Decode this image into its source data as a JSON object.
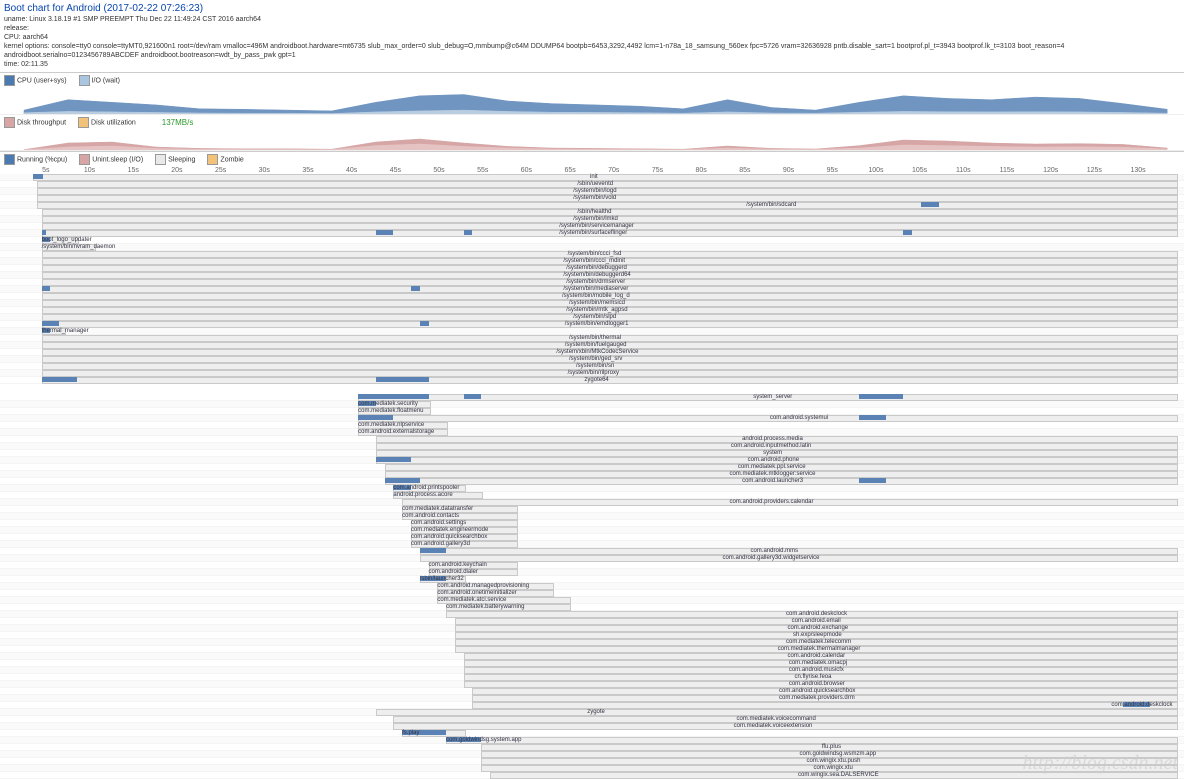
{
  "header": {
    "title": "Boot chart for Android (2017-02-22 07:26:23)",
    "uname": "uname: Linux 3.18.19 #1 SMP PREEMPT Thu Dec 22 11:49:24 CST 2016 aarch64",
    "release": "release:",
    "cpu": "CPU: aarch64",
    "cmdline": "kernel options: console=tty0 console=ttyMT0,921600n1 root=/dev/ram vmalloc=496M androidboot.hardware=mt6735 slub_max_order=0 slub_debug=O,mmbump@c64M DDUMP64 bootpb=6453,3292,4492 lcm=1-n78a_18_samsung_560ex fpc=5726 vram=32636928 pntb.disable_sart=1 bootprof.pl_t=3943 bootprof.lk_t=3103 boot_reason=4 androidboot.serialno=0123456789ABCDEF androidboot.bootreason=wdt_by_pass_pwk gpt=1",
    "time": "time: 02:11.35"
  },
  "legend_cpu": {
    "title": "CPU (user+sys)",
    "io": "I/O (wait)"
  },
  "legend_disk": {
    "title": "Disk throughput",
    "value": "137MB/s",
    "disk_util": "Disk utilization"
  },
  "legend_proc": {
    "running": "Running (%cpu)",
    "unint": "Unint.sleep (I/O)",
    "sleeping": "Sleeping",
    "zombie": "Zombie"
  },
  "ticks": [
    "5s",
    "10s",
    "15s",
    "20s",
    "25s",
    "30s",
    "35s",
    "40s",
    "45s",
    "50s",
    "55s",
    "60s",
    "65s",
    "70s",
    "75s",
    "80s",
    "85s",
    "90s",
    "95s",
    "100s",
    "105s",
    "110s",
    "115s",
    "120s",
    "125s",
    "130s"
  ],
  "watermark": "http://blog.csdn.net",
  "chart_data": {
    "type": "gantt",
    "title": "Boot chart for Android (2017-02-22 07:26:23)",
    "x_unit": "seconds",
    "x_range": [
      0,
      131
    ],
    "cpu_wave": {
      "description": "CPU (user+sys) and I/O(wait) stacked area",
      "samples_s": [
        0,
        5,
        10,
        15,
        20,
        25,
        30,
        35,
        40,
        45,
        50,
        55,
        60,
        65,
        70,
        75,
        80,
        85,
        90,
        95,
        100,
        105,
        110,
        115,
        120,
        125,
        130
      ],
      "cpu_pct": [
        15,
        55,
        45,
        35,
        20,
        18,
        15,
        12,
        45,
        70,
        75,
        50,
        40,
        35,
        30,
        20,
        55,
        25,
        15,
        45,
        70,
        60,
        55,
        65,
        60,
        40,
        18
      ],
      "io_pct": [
        5,
        10,
        8,
        6,
        4,
        3,
        3,
        2,
        8,
        12,
        15,
        10,
        7,
        6,
        5,
        3,
        8,
        4,
        3,
        7,
        10,
        9,
        8,
        9,
        8,
        6,
        3
      ]
    },
    "disk_wave": {
      "description": "Disk throughput (pink) and utilization stacked",
      "samples_s": [
        0,
        5,
        10,
        15,
        20,
        25,
        30,
        35,
        40,
        45,
        50,
        55,
        60,
        65,
        70,
        75,
        80,
        85,
        90,
        95,
        100,
        105,
        110,
        115,
        120,
        125,
        130
      ],
      "thr_pct": [
        2,
        35,
        40,
        15,
        8,
        6,
        6,
        4,
        40,
        55,
        35,
        18,
        10,
        8,
        6,
        4,
        20,
        8,
        5,
        22,
        50,
        45,
        35,
        30,
        32,
        28,
        10
      ],
      "util_pct": [
        1,
        15,
        20,
        8,
        4,
        3,
        3,
        2,
        22,
        30,
        18,
        10,
        5,
        4,
        3,
        2,
        10,
        4,
        3,
        10,
        25,
        22,
        18,
        15,
        16,
        14,
        5
      ]
    },
    "processes": [
      {
        "name": "init",
        "start": 1,
        "end": 131,
        "label_x": 65,
        "activity": [
          [
            1,
            2
          ],
          [
            1.5,
            2.2
          ]
        ]
      },
      {
        "name": "/sbin/ueventd",
        "start": 1.5,
        "end": 131,
        "label_x": 65
      },
      {
        "name": "/system/bin/logd",
        "start": 1.5,
        "end": 131,
        "label_x": 65
      },
      {
        "name": "/system/bin/vold",
        "start": 1.5,
        "end": 131,
        "label_x": 65
      },
      {
        "name": "/system/bin/sdcard",
        "start": 1.5,
        "end": 131,
        "label_x": 85,
        "activity": [
          [
            102,
            104
          ]
        ]
      },
      {
        "name": "/sbin/healthd",
        "start": 2,
        "end": 131,
        "label_x": 65
      },
      {
        "name": "/system/bin/lmkd",
        "start": 2,
        "end": 131,
        "label_x": 65
      },
      {
        "name": "/system/bin/servicemanager",
        "start": 2,
        "end": 131,
        "label_x": 65
      },
      {
        "name": "/system/bin/surfaceflinger",
        "start": 2,
        "end": 131,
        "label_x": 65,
        "activity": [
          [
            2,
            2.5
          ],
          [
            40,
            42
          ],
          [
            50,
            51
          ],
          [
            100,
            101
          ]
        ]
      },
      {
        "name": "boot_logo_updater",
        "start": 2,
        "end": 6,
        "label_x": 6,
        "label_side": "left",
        "activity": [
          [
            2,
            3
          ]
        ]
      },
      {
        "name": "/system/bin/nvram_daemon",
        "start": 2,
        "end": 8,
        "label_x": 8,
        "label_side": "left"
      },
      {
        "name": "/system/bin/ccci_fsd",
        "start": 2,
        "end": 131,
        "label_x": 65
      },
      {
        "name": "/system/bin/ccci_mdinit",
        "start": 2,
        "end": 131,
        "label_x": 65
      },
      {
        "name": "/system/bin/debuggerd",
        "start": 2,
        "end": 131,
        "label_x": 65
      },
      {
        "name": "/system/bin/debuggerd64",
        "start": 2,
        "end": 131,
        "label_x": 65
      },
      {
        "name": "/system/bin/drmserver",
        "start": 2,
        "end": 131,
        "label_x": 65
      },
      {
        "name": "/system/bin/mediaserver",
        "start": 2,
        "end": 131,
        "label_x": 65,
        "activity": [
          [
            2,
            3
          ],
          [
            44,
            45
          ]
        ]
      },
      {
        "name": "/system/bin/mobile_log_d",
        "start": 2,
        "end": 131,
        "label_x": 65
      },
      {
        "name": "/system/bin/memsicd",
        "start": 2,
        "end": 131,
        "label_x": 65
      },
      {
        "name": "/system/bin/mtk_agpsd",
        "start": 2,
        "end": 131,
        "label_x": 65
      },
      {
        "name": "/system/bin/slpd",
        "start": 2,
        "end": 131,
        "label_x": 65
      },
      {
        "name": "/system/bin/emdlogger1",
        "start": 2,
        "end": 131,
        "label_x": 65,
        "activity": [
          [
            2,
            4
          ],
          [
            45,
            46
          ]
        ]
      },
      {
        "name": "thermal_manager",
        "start": 2,
        "end": 4.5,
        "label_x": 4.5,
        "label_side": "left",
        "activity": [
          [
            2,
            3
          ]
        ]
      },
      {
        "name": "/system/bin/thermal",
        "start": 2,
        "end": 131,
        "label_x": 65
      },
      {
        "name": "/system/bin/fuelgauged",
        "start": 2,
        "end": 131,
        "label_x": 65
      },
      {
        "name": "/system/xbin/MtkCodecService",
        "start": 2,
        "end": 131,
        "label_x": 65
      },
      {
        "name": "/system/bin/ged_srv",
        "start": 2,
        "end": 131,
        "label_x": 65
      },
      {
        "name": "/system/bin/sn",
        "start": 2,
        "end": 131,
        "label_x": 65
      },
      {
        "name": "/system/bin/rilproxy",
        "start": 2,
        "end": 131,
        "label_x": 65
      },
      {
        "name": "zygote64",
        "start": 2,
        "end": 131,
        "label_x": 65,
        "activity": [
          [
            2,
            6
          ],
          [
            40,
            46
          ]
        ]
      },
      {
        "name": "system_server",
        "start": 38,
        "end": 131,
        "label_x": 85,
        "activity": [
          [
            38,
            46
          ],
          [
            50,
            52
          ],
          [
            95,
            100
          ]
        ]
      },
      {
        "name": "com.mediatek.security",
        "start": 38,
        "end": 46,
        "label_x": 46,
        "label_side": "left",
        "activity": [
          [
            38,
            40
          ]
        ]
      },
      {
        "name": "com.mediatek.floatmenu",
        "start": 38,
        "end": 46,
        "label_x": 46,
        "label_side": "left"
      },
      {
        "name": "com.android.systemui",
        "start": 38,
        "end": 131,
        "label_x": 88,
        "activity": [
          [
            38,
            42
          ],
          [
            95,
            98
          ]
        ]
      },
      {
        "name": "com.mediatek.nlpservice",
        "start": 38,
        "end": 48,
        "label_x": 48,
        "label_side": "left"
      },
      {
        "name": "com.android.externalstorage",
        "start": 38,
        "end": 48,
        "label_x": 48,
        "label_side": "left"
      },
      {
        "name": "android.process.media",
        "start": 40,
        "end": 131,
        "label_x": 85
      },
      {
        "name": "com.android.inputmethod.latin",
        "start": 40,
        "end": 131,
        "label_x": 85
      },
      {
        "name": "system",
        "start": 40,
        "end": 131,
        "label_x": 85
      },
      {
        "name": "com.android.phone",
        "start": 40,
        "end": 131,
        "label_x": 85,
        "activity": [
          [
            40,
            44
          ]
        ]
      },
      {
        "name": "com.mediatek.ppl.service",
        "start": 41,
        "end": 131,
        "label_x": 85
      },
      {
        "name": "com.mediatek.mtklogger:service",
        "start": 41,
        "end": 131,
        "label_x": 85
      },
      {
        "name": "com.android.launcher3",
        "start": 41,
        "end": 131,
        "label_x": 85,
        "activity": [
          [
            41,
            45
          ],
          [
            95,
            98
          ]
        ]
      },
      {
        "name": "com.android.printspooler",
        "start": 42,
        "end": 50,
        "label_x": 50,
        "label_side": "left",
        "activity": [
          [
            42,
            44
          ]
        ]
      },
      {
        "name": "android.process.acore",
        "start": 42,
        "end": 52,
        "label_x": 52,
        "label_side": "left"
      },
      {
        "name": "com.android.providers.calendar",
        "start": 43,
        "end": 131,
        "label_x": 85
      },
      {
        "name": "com.mediatek.datatransfer",
        "start": 43,
        "end": 56,
        "label_x": 56,
        "label_side": "left"
      },
      {
        "name": "com.android.contacts",
        "start": 43,
        "end": 56,
        "label_x": 56,
        "label_side": "left"
      },
      {
        "name": "com.android.settings",
        "start": 44,
        "end": 56,
        "label_x": 56,
        "label_side": "left"
      },
      {
        "name": "com.mediatek.engineermode",
        "start": 44,
        "end": 56,
        "label_x": 56,
        "label_side": "left"
      },
      {
        "name": "com.android.quicksearchbox",
        "start": 44,
        "end": 56,
        "label_x": 56,
        "label_side": "left"
      },
      {
        "name": "com.android.gallery3d",
        "start": 44,
        "end": 56,
        "label_x": 56,
        "label_side": "left"
      },
      {
        "name": "com.android.mms",
        "start": 45,
        "end": 131,
        "label_x": 85,
        "activity": [
          [
            45,
            48
          ]
        ]
      },
      {
        "name": "com.android.gallery3d.widgetservice",
        "start": 45,
        "end": 131,
        "label_x": 85
      },
      {
        "name": "com.android.keychain",
        "start": 46,
        "end": 56,
        "label_x": 56,
        "label_side": "left"
      },
      {
        "name": "com.android.dialer",
        "start": 46,
        "end": 56,
        "label_x": 56,
        "label_side": "left"
      },
      {
        "name": "/sbin/launcher32",
        "start": 45,
        "end": 50,
        "label_x": 50,
        "label_side": "left",
        "activity": [
          [
            45,
            48
          ]
        ]
      },
      {
        "name": "com.android.managedprovisioning",
        "start": 47,
        "end": 60,
        "label_x": 60,
        "label_side": "left"
      },
      {
        "name": "com.android.onetimeinitializer",
        "start": 47,
        "end": 60,
        "label_x": 60,
        "label_side": "left"
      },
      {
        "name": "com.mediatek.atci.service",
        "start": 47,
        "end": 62,
        "label_x": 62,
        "label_side": "left"
      },
      {
        "name": "com.mediatek.batterywarning",
        "start": 48,
        "end": 62,
        "label_x": 62,
        "label_side": "left"
      },
      {
        "name": "com.android.deskclock",
        "start": 48,
        "end": 131,
        "label_x": 90
      },
      {
        "name": "com.android.email",
        "start": 49,
        "end": 131,
        "label_x": 90
      },
      {
        "name": "com.android.exchange",
        "start": 49,
        "end": 131,
        "label_x": 90
      },
      {
        "name": "sh.exp/sleepmode",
        "start": 49,
        "end": 131,
        "label_x": 90
      },
      {
        "name": "com.mediatek.telecomm",
        "start": 49,
        "end": 131,
        "label_x": 90
      },
      {
        "name": "com.mediatek.thermalmanager",
        "start": 49,
        "end": 131,
        "label_x": 90
      },
      {
        "name": "com.android.calendar",
        "start": 50,
        "end": 131,
        "label_x": 90
      },
      {
        "name": "com.mediatek.omacpj",
        "start": 50,
        "end": 131,
        "label_x": 90
      },
      {
        "name": "com.android.musicfx",
        "start": 50,
        "end": 131,
        "label_x": 90
      },
      {
        "name": "cn.flyrise.feoa",
        "start": 50,
        "end": 131,
        "label_x": 90
      },
      {
        "name": "com.android.browser",
        "start": 50,
        "end": 131,
        "label_x": 90
      },
      {
        "name": "com.android.quicksearchbox",
        "start": 51,
        "end": 131,
        "label_x": 90
      },
      {
        "name": "com.mediatek.providers.drm",
        "start": 51,
        "end": 131,
        "label_x": 90
      },
      {
        "name": "com.android.deskclock",
        "start": 51,
        "end": 131,
        "label_x": 127,
        "activity": [
          [
            125,
            128
          ]
        ]
      },
      {
        "name": "zygote",
        "start": 40,
        "end": 131,
        "label_x": 65
      },
      {
        "name": "com.mediatek.voicecommand",
        "start": 42,
        "end": 131,
        "label_x": 85
      },
      {
        "name": "com.mediatek.voiceextension",
        "start": 42,
        "end": 131,
        "label_x": 85
      },
      {
        "name": "fs.play",
        "start": 43,
        "end": 50,
        "label_x": 50,
        "label_side": "left",
        "activity": [
          [
            43,
            48
          ]
        ]
      },
      {
        "name": "com.goldwindsg.system.app",
        "start": 48,
        "end": 131,
        "label_x": 62,
        "label_side": "left",
        "activity": [
          [
            48,
            52
          ]
        ]
      },
      {
        "name": "ffu.plus",
        "start": 52,
        "end": 131,
        "label_x": 92
      },
      {
        "name": "com.goldwindsg.wsmzm.app",
        "start": 52,
        "end": 131,
        "label_x": 92
      },
      {
        "name": "com.wingix.xtu.push",
        "start": 52,
        "end": 131,
        "label_x": 92
      },
      {
        "name": "com.wingix.xtu",
        "start": 52,
        "end": 131,
        "label_x": 92
      },
      {
        "name": "com.wingix.sea.DALSERVICE",
        "start": 53,
        "end": 131,
        "label_x": 92
      }
    ]
  }
}
